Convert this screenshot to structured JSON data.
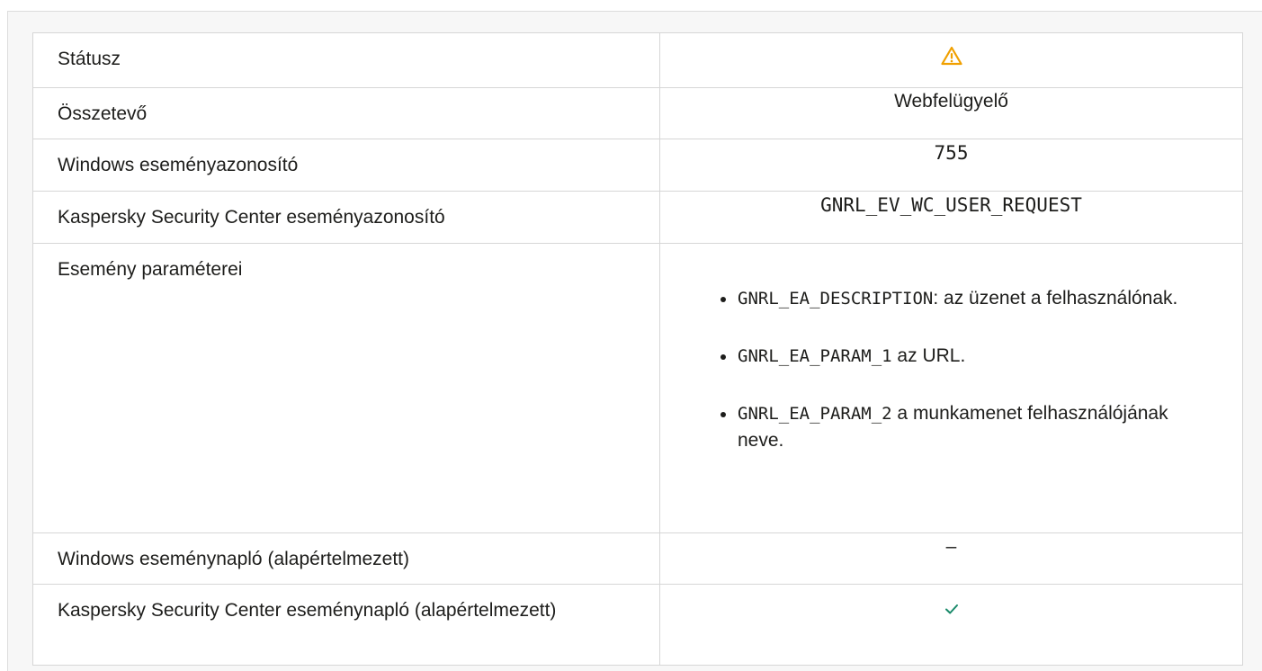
{
  "rows": {
    "status": {
      "label": "Státusz",
      "icon": "warning-icon",
      "icon_color": "#f0a000"
    },
    "component": {
      "label": "Összetevő",
      "value": "Webfelügyelő"
    },
    "windows_event_id": {
      "label": "Windows eseményazonosító",
      "value": "755"
    },
    "ksc_event_id": {
      "label": "Kaspersky Security Center eseményazonosító",
      "value": "GNRL_EV_WC_USER_REQUEST"
    },
    "event_params": {
      "label": "Esemény paraméterei",
      "items": [
        {
          "code": "GNRL_EA_DESCRIPTION",
          "text": ": az üzenet a felhasználónak."
        },
        {
          "code": "GNRL_EA_PARAM_1",
          "text": " az URL."
        },
        {
          "code": "GNRL_EA_PARAM_2",
          "text": " a munkamenet felhasználójának neve."
        }
      ]
    },
    "windows_log": {
      "label": "Windows eseménynapló (alapértelmezett)",
      "value": "–"
    },
    "ksc_log": {
      "label": "Kaspersky Security Center eseménynapló (alapértelmezett)",
      "icon": "checkmark-icon",
      "icon_color": "#1a8a6a"
    }
  }
}
